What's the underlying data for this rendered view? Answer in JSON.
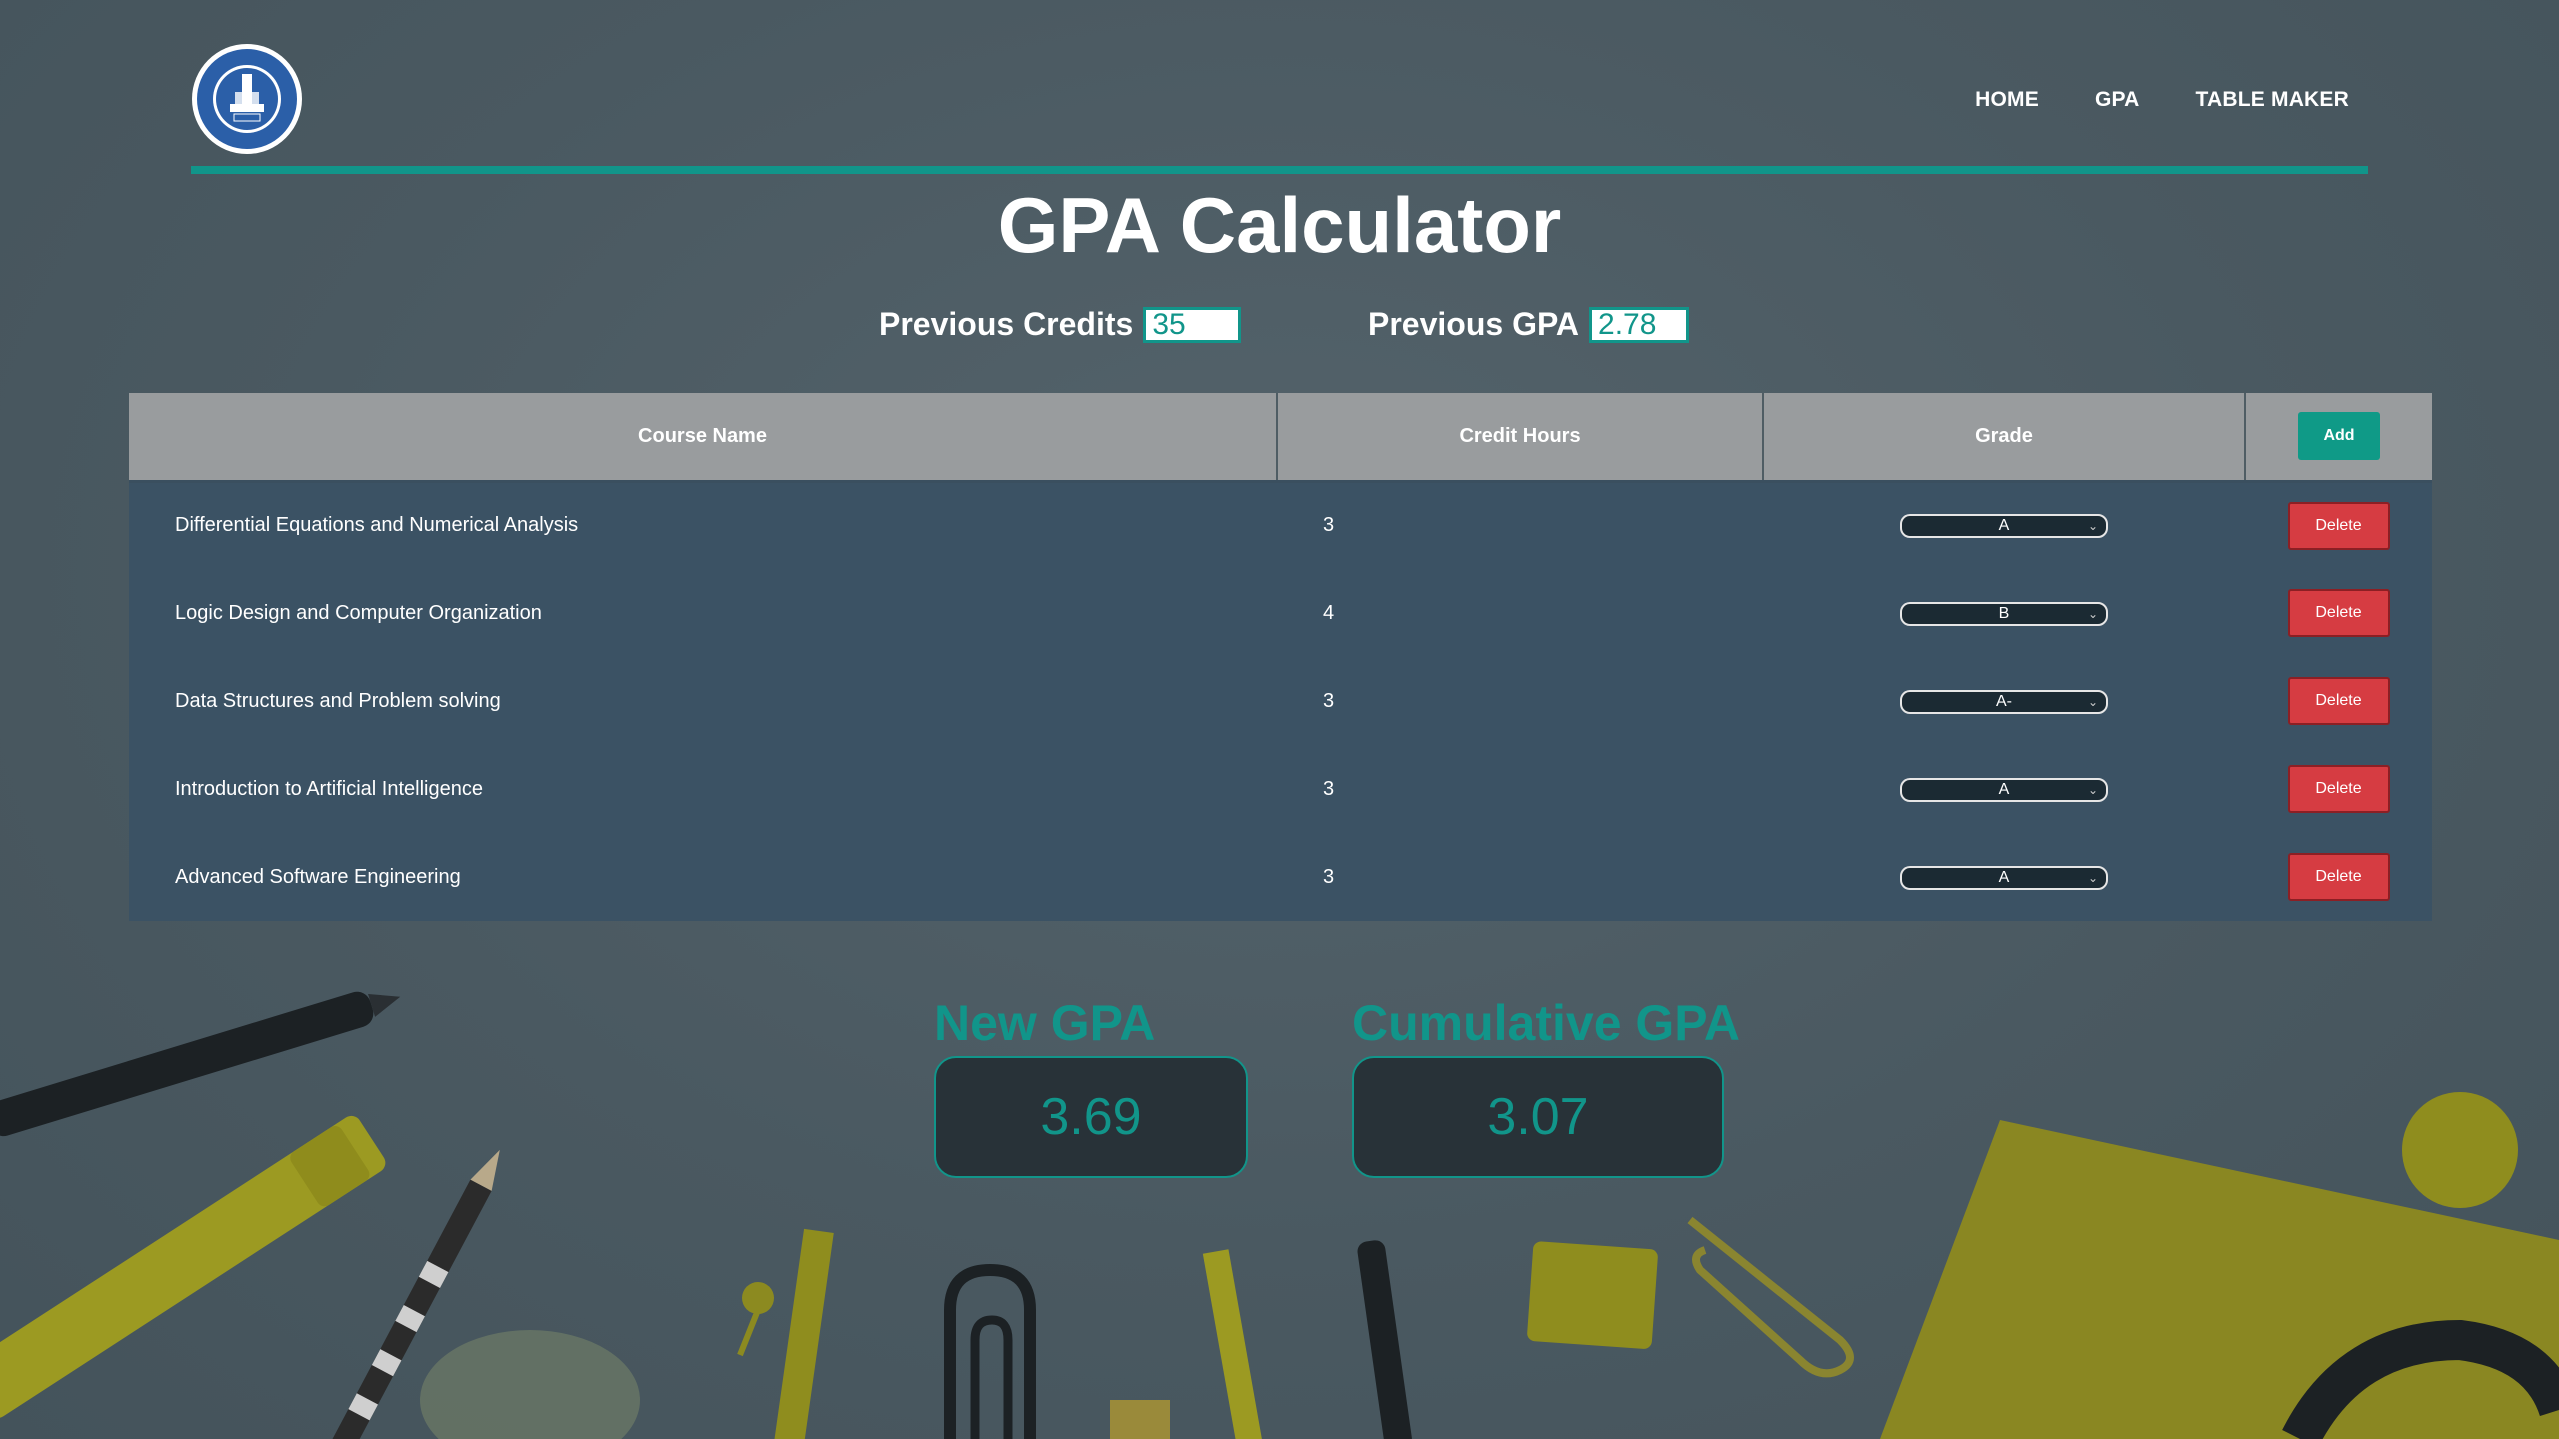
{
  "header": {
    "logo_alt": "Faculty of Engineering Ain Shams University ICHEP logo",
    "nav": {
      "home": "HOME",
      "gpa": "GPA",
      "table_maker": "TABLE MAKER"
    }
  },
  "title": "GPA Calculator",
  "previous": {
    "credits_label": "Previous Credits",
    "credits_value": "35",
    "gpa_label": "Previous GPA",
    "gpa_value": "2.78"
  },
  "table": {
    "headers": {
      "course_name": "Course Name",
      "credit_hours": "Credit Hours",
      "grade": "Grade",
      "add_button": "Add"
    },
    "delete_label": "Delete",
    "rows": [
      {
        "course": "Differential Equations and Numerical Analysis",
        "credits": "3",
        "grade": "A"
      },
      {
        "course": "Logic Design and Computer Organization",
        "credits": "4",
        "grade": "B"
      },
      {
        "course": "Data Structures and Problem solving",
        "credits": "3",
        "grade": "A-"
      },
      {
        "course": "Introduction to Artificial Intelligence",
        "credits": "3",
        "grade": "A"
      },
      {
        "course": "Advanced Software Engineering",
        "credits": "3",
        "grade": "A"
      }
    ]
  },
  "results": {
    "new_gpa_label": "New GPA",
    "new_gpa_value": "3.69",
    "cumulative_gpa_label": "Cumulative GPA",
    "cumulative_gpa_value": "3.07"
  },
  "colors": {
    "accent": "#11958a",
    "delete": "#d63c42",
    "table_header": "#999c9e",
    "table_body": "#3b5264"
  }
}
